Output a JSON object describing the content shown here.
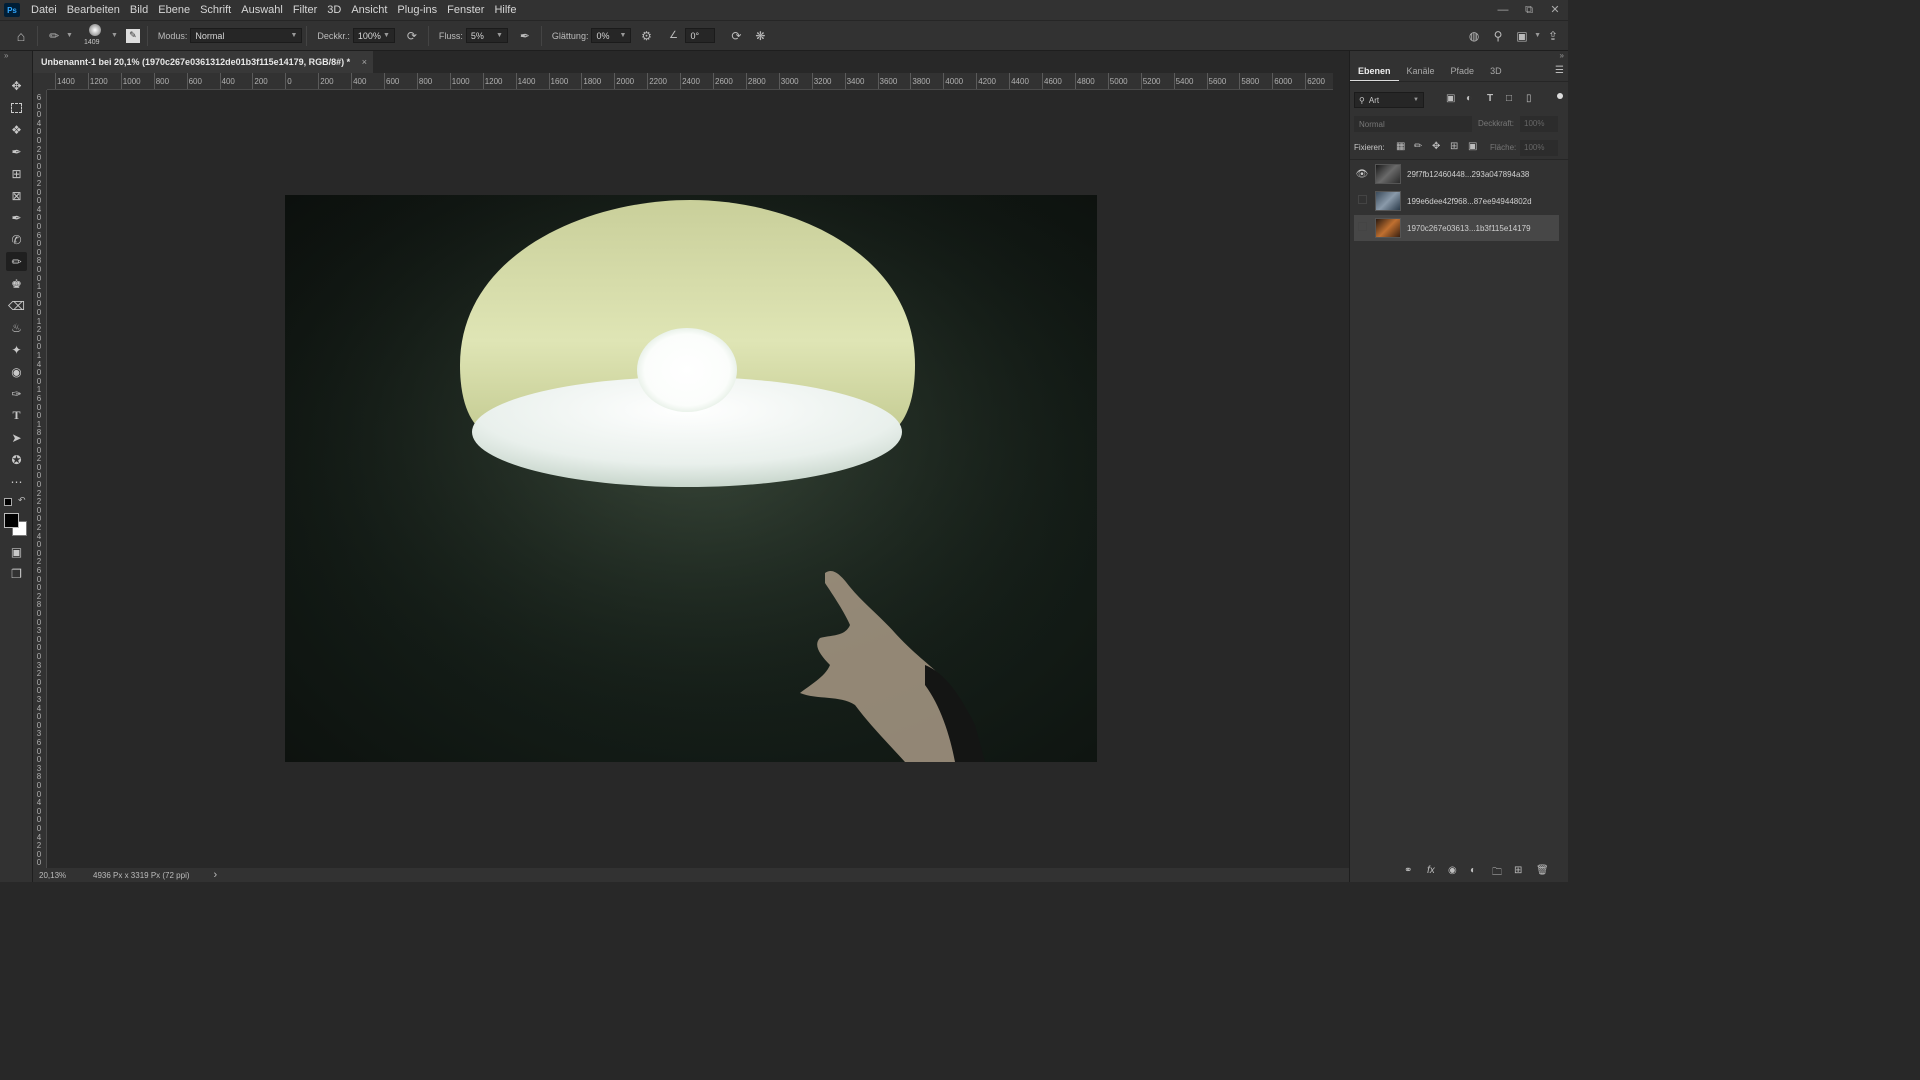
{
  "app": {
    "logo": "Ps"
  },
  "menu": [
    "Datei",
    "Bearbeiten",
    "Bild",
    "Ebene",
    "Schrift",
    "Auswahl",
    "Filter",
    "3D",
    "Ansicht",
    "Plug-ins",
    "Fenster",
    "Hilfe"
  ],
  "options": {
    "brush_size": "1409",
    "mode_label": "Modus:",
    "mode_value": "Normal",
    "opacity_label": "Deckkr.:",
    "opacity_value": "100%",
    "flow_label": "Fluss:",
    "flow_value": "5%",
    "smoothing_label": "Glättung:",
    "smoothing_value": "0%",
    "angle_value": "0°"
  },
  "document": {
    "tab_title": "Unbenannt-1 bei 20,1% (1970c267e0361312de01b3f115e14179, RGB/8#) *",
    "close": "×"
  },
  "ruler_top": [
    "1400",
    "1200",
    "1000",
    "800",
    "600",
    "400",
    "200",
    "0",
    "200",
    "400",
    "600",
    "800",
    "1000",
    "1200",
    "1400",
    "1600",
    "1800",
    "2000",
    "2200",
    "2400",
    "2600",
    "2800",
    "3000",
    "3200",
    "3400",
    "3600",
    "3800",
    "4000",
    "4200",
    "4400",
    "4600",
    "4800",
    "5000",
    "5200",
    "5400",
    "5600",
    "5800",
    "6000",
    "6200"
  ],
  "status": {
    "zoom": "20,13%",
    "dimensions": "4936 Px x 3319 Px (72 ppi)",
    "arrow": "›"
  },
  "panel": {
    "tabs": [
      "Ebenen",
      "Kanäle",
      "Pfade",
      "3D"
    ],
    "search_kind": "Art",
    "blend_mode": "Normal",
    "opacity_label": "Deckkraft:",
    "opacity_value": "100%",
    "lock_label": "Fixieren:",
    "fill_label": "Fläche:",
    "fill_value": "100%",
    "layers": [
      {
        "name": "29f7fb12460448...293a047894a38",
        "visible": true,
        "selected": false
      },
      {
        "name": "199e6dee42f968...87ee94944802d",
        "visible": false,
        "selected": false
      },
      {
        "name": "1970c267e03613...1b3f115e14179",
        "visible": false,
        "selected": true
      }
    ]
  },
  "colors": {
    "ui_dark": "#323232",
    "canvas_bg": "#282828",
    "foreground": "#000000",
    "background": "#ffffff"
  }
}
